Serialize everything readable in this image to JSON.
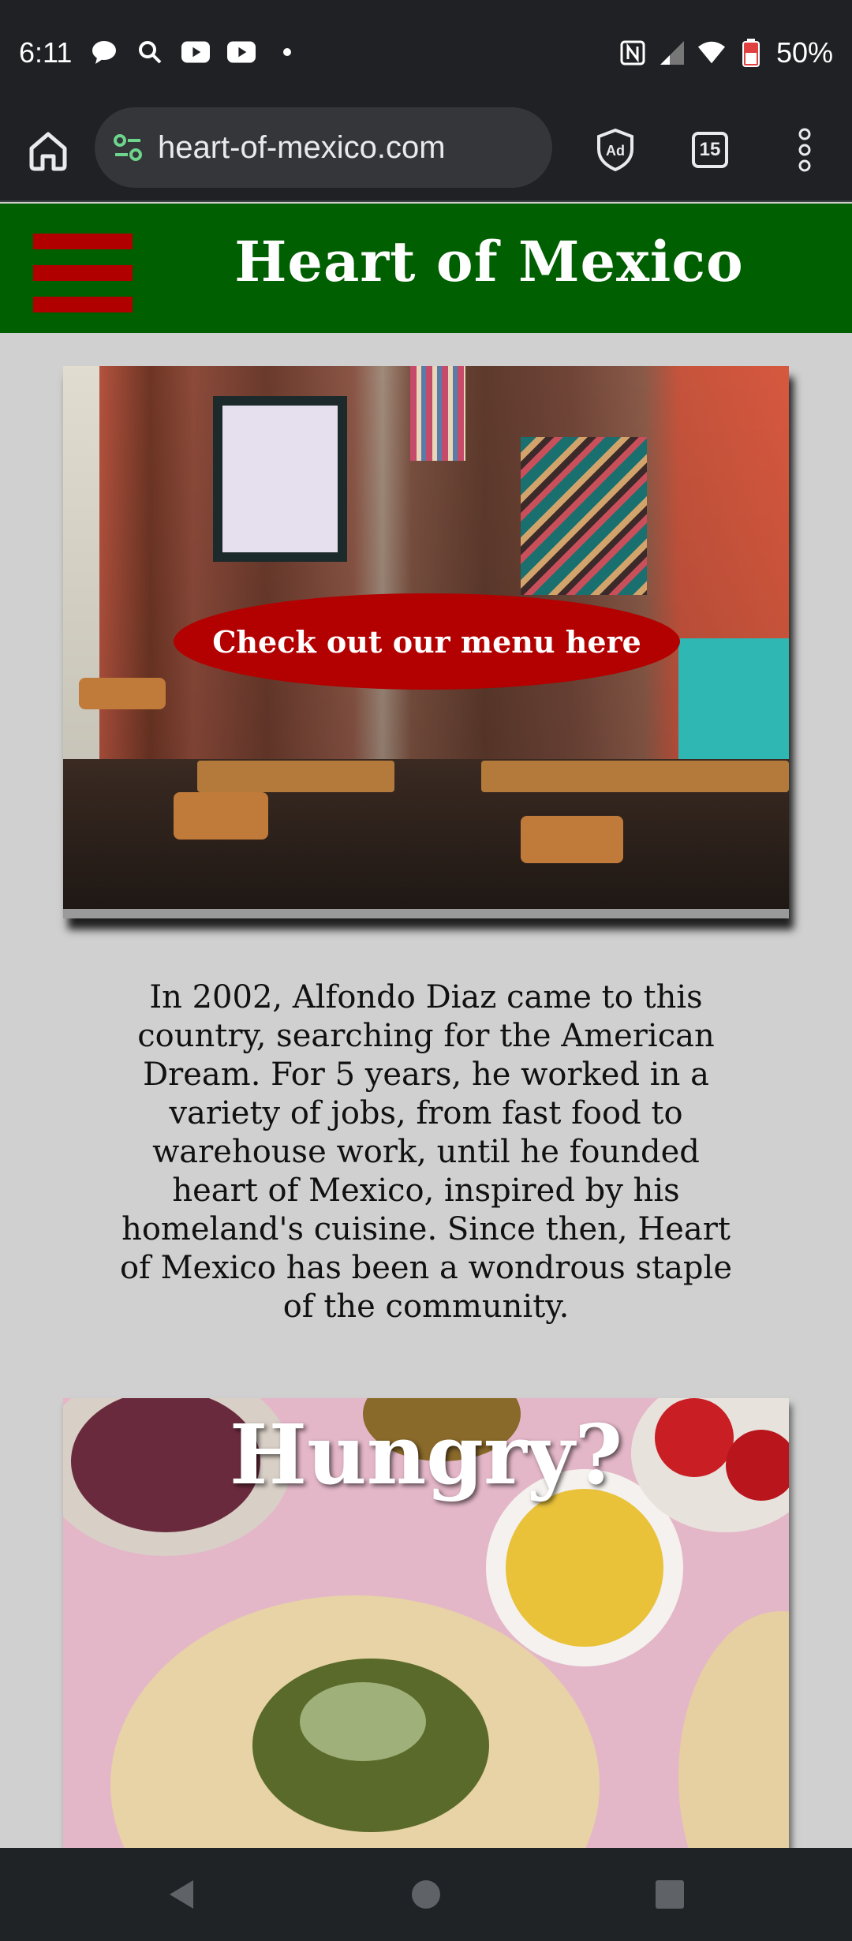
{
  "status_bar": {
    "time": "6:11",
    "battery": "50%",
    "left_icons": [
      "chat-bubble-icon",
      "search-icon",
      "youtube-icon",
      "youtube-icon",
      "dot-icon"
    ],
    "right_icons": [
      "nfc-icon",
      "signal-icon",
      "wifi-icon",
      "battery-icon"
    ]
  },
  "browser": {
    "url": "heart-of-mexico.com",
    "tab_count": "15",
    "icons": [
      "home-icon",
      "site-settings-icon",
      "adblock-icon",
      "tabs-icon",
      "more-vert-icon"
    ],
    "toolbar_color": "#202124"
  },
  "site": {
    "title": "Heart of Mexico",
    "header_color": "#005f00",
    "accent_color": "#b30000",
    "menu_cta": "Check out our menu here",
    "story": "In 2002, Alfondo Diaz came to this country, searching for the American Dream. For 5 years, he worked in a variety of jobs, from fast food to warehouse work, until he founded heart of Mexico, inspired by his homeland's cuisine. Since then, Heart of Mexico has been a wondrous staple of the community.",
    "hungry_title": "Hungry?"
  },
  "nav_bar": {
    "icons": [
      "back-icon",
      "home-circle-icon",
      "recents-icon"
    ]
  }
}
